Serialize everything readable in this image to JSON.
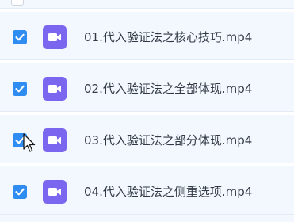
{
  "colors": {
    "row_background": "#f3f8fe",
    "checkbox_checked": "#2f8cf0",
    "video_icon": "#7b66f0",
    "text": "#333a45"
  },
  "files": [
    {
      "name": "01.代入验证法之核心技巧.mp4",
      "checked": true,
      "icon": "video-file-icon"
    },
    {
      "name": "02.代入验证法之全部体现.mp4",
      "checked": true,
      "icon": "video-file-icon"
    },
    {
      "name": "03.代入验证法之部分体现.mp4",
      "checked": true,
      "icon": "video-file-icon"
    },
    {
      "name": "04.代入验证法之侧重选项.mp4",
      "checked": true,
      "icon": "video-file-icon"
    }
  ]
}
